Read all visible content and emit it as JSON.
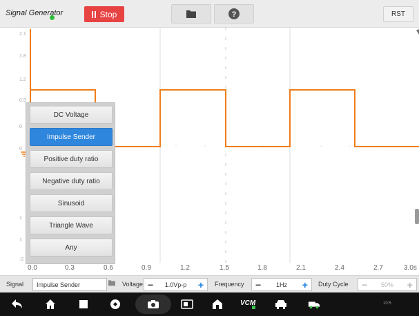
{
  "topbar": {
    "title": "Signal Generator",
    "stop_label": "Stop",
    "rst_label": "RST",
    "icons": {
      "folder": "folder-icon",
      "help": "help-icon",
      "pause": "pause-icon"
    }
  },
  "plot": {
    "y_ticks": [
      "2.1",
      "1.8",
      "1.2",
      "0.9",
      "0",
      "0",
      "1",
      "1",
      "-2"
    ],
    "x_ticks": [
      "0.0",
      "0.3",
      "0.6",
      "0.9",
      "1.2",
      "1.5",
      "1.8",
      "2.1",
      "2.4",
      "2.7",
      "3.0s"
    ],
    "colors": {
      "trace": "#f07d1a",
      "grid": "#d4d4d4",
      "axis": "#f07d1a"
    }
  },
  "signal_menu": {
    "items": [
      "DC Voltage",
      "Impulse Sender",
      "Positive duty ratio",
      "Negative duty ratio",
      "Sinusoid",
      "Triangle Wave",
      "Any"
    ],
    "selected_index": 1
  },
  "params": {
    "signal_label": "Signal",
    "signal_value": "Impulse Sender",
    "voltage_label": "Voltage",
    "voltage_value": "1.0Vp-p",
    "frequency_label": "Frequency",
    "frequency_value": "1Hz",
    "duty_label": "Duty Cycle",
    "duty_value": "50%"
  },
  "navbar": {
    "vcm_label": "VCM",
    "status_tray": "10:5",
    "icons": [
      "back-icon",
      "home-icon",
      "recent-apps-icon",
      "browser-icon",
      "camera-icon",
      "screen-record-icon",
      "shop-icon",
      "vcm-icon",
      "car-icon",
      "truck-icon",
      "status-tray-icon"
    ]
  }
}
